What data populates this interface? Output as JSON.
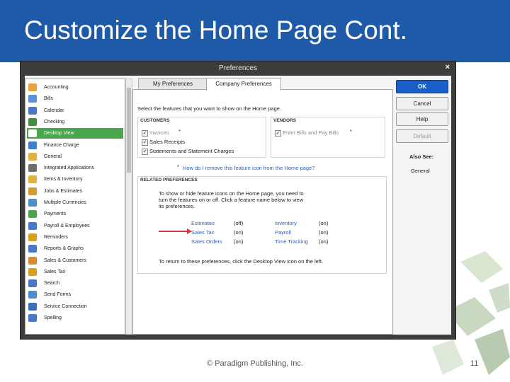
{
  "slide": {
    "title": "Customize the Home Page Cont.",
    "footer": "© Paradigm Publishing, Inc.",
    "page_number": "11"
  },
  "dialog": {
    "title": "Preferences",
    "close": "×",
    "sidebar": [
      {
        "label": "Accounting",
        "color": "#e8a33c"
      },
      {
        "label": "Bills",
        "color": "#5b8fd6"
      },
      {
        "label": "Calendar",
        "color": "#4a78c8"
      },
      {
        "label": "Checking",
        "color": "#3f8f3f"
      },
      {
        "label": "Desktop View",
        "color": "#ffffff",
        "selected": true
      },
      {
        "label": "Finance Charge",
        "color": "#3c7fc7"
      },
      {
        "label": "General",
        "color": "#e0b040"
      },
      {
        "label": "Integrated Applications",
        "color": "#6e6e6e"
      },
      {
        "label": "Items & Inventory",
        "color": "#e0b040"
      },
      {
        "label": "Jobs & Estimates",
        "color": "#d89a2c"
      },
      {
        "label": "Multiple Currencies",
        "color": "#4a8fcc"
      },
      {
        "label": "Payments",
        "color": "#4aa64a"
      },
      {
        "label": "Payroll & Employees",
        "color": "#4a78c8"
      },
      {
        "label": "Reminders",
        "color": "#d8a020"
      },
      {
        "label": "Reports & Graphs",
        "color": "#4a78c8"
      },
      {
        "label": "Sales & Customers",
        "color": "#d88a2c"
      },
      {
        "label": "Sales Tax",
        "color": "#d8a020"
      },
      {
        "label": "Search",
        "color": "#4a78c8"
      },
      {
        "label": "Send Forms",
        "color": "#4a8fcc"
      },
      {
        "label": "Service Connection",
        "color": "#3c6fb8"
      },
      {
        "label": "Spelling",
        "color": "#4a78c8"
      }
    ],
    "tabs": {
      "my": "My Preferences",
      "company": "Company Preferences"
    },
    "instruction": "Select the features that you want to show on the Home page.",
    "customers": {
      "group": "CUSTOMERS",
      "invoices": "Invoices",
      "sales_receipts": "Sales Receipts",
      "statements": "Statements and Statement Charges",
      "asterisk": "*"
    },
    "vendors": {
      "group": "VENDORS",
      "enter_bills": "Enter Bills and Pay Bills",
      "asterisk": "*"
    },
    "remove_link": "How do I remove this feature icon from the Home page?",
    "related": {
      "group": "RELATED PREFERENCES",
      "desc_1": "To show or hide feature icons on the Home page, you need to",
      "desc_2": "turn the features on or off. Click a feature name below to view",
      "desc_3": "its preferences.",
      "rows": [
        {
          "a": "Estimates",
          "a_state": "(off)",
          "b": "Inventory",
          "b_state": "(on)"
        },
        {
          "a": "Sales Tax",
          "a_state": "(on)",
          "b": "Payroll",
          "b_state": "(on)"
        },
        {
          "a": "Sales Orders",
          "a_state": "(on)",
          "b": "Time Tracking",
          "b_state": "(on)"
        }
      ],
      "return_note": "To return to these preferences, click the Desktop View icon on the left."
    },
    "buttons": {
      "ok": "OK",
      "cancel": "Cancel",
      "help": "Help",
      "default": "Default"
    },
    "also_see": {
      "label": "Also See:",
      "general": "General"
    },
    "colors": {
      "header": "#1e5aa8",
      "selected": "#4aa64a",
      "link": "#2a5fb8",
      "arrow": "#d23a3a"
    }
  }
}
